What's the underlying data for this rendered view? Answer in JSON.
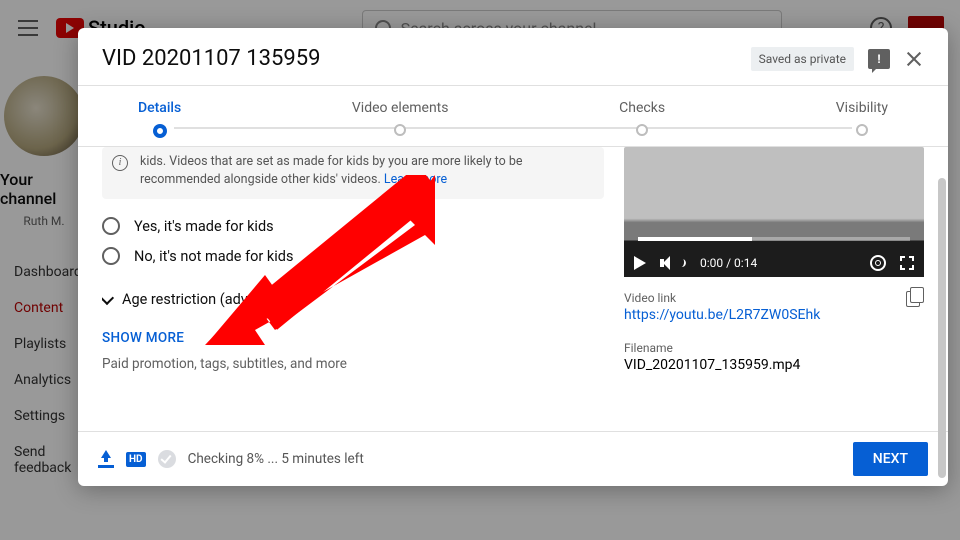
{
  "shell": {
    "brand": "Studio",
    "search_placeholder": "Search across your channel",
    "channel_title": "Your channel",
    "channel_sub": "Ruth M.",
    "nav": [
      "Dashboard",
      "Content",
      "Playlists",
      "Analytics",
      "Settings",
      "Send feedback"
    ]
  },
  "modal": {
    "title": "VID 20201107 135959",
    "save_badge": "Saved as private",
    "steps": [
      "Details",
      "Video elements",
      "Checks",
      "Visibility"
    ],
    "info_text": "kids. Videos that are set as made for kids by you are more likely to be recommended alongside other kids' videos. ",
    "info_link": "Learn more",
    "radio_yes": "Yes, it's made for kids",
    "radio_no": "No, it's not made for kids",
    "age_restrict": "Age restriction (advanced)",
    "show_more": "SHOW MORE",
    "show_more_sub": "Paid promotion, tags, subtitles, and more",
    "player_time": "0:00 / 0:14",
    "link_label": "Video link",
    "link_value": "https://youtu.be/L2R7ZW0SEhk",
    "file_label": "Filename",
    "file_value": "VID_20201107_135959.mp4",
    "hd": "HD",
    "status": "Checking 8% ... 5 minutes left",
    "next": "NEXT"
  }
}
